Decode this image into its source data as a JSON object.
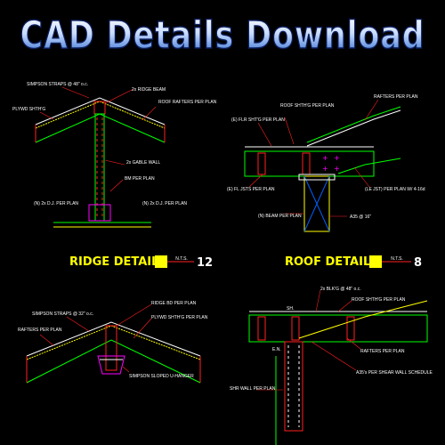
{
  "banner": {
    "title": "CAD Details Download"
  },
  "details": [
    {
      "title": "RIDGE DETAIL",
      "scale": "N.T.S.",
      "number": "12",
      "labels": {
        "simpson": "SIMPSON STRAPS @ 48\" o.c.",
        "ridge_beam": "2x RIDGE BEAM",
        "plywood": "PLYWD SHTH'G",
        "roof_rafters": "ROOF RAFTERS PER PLAN",
        "gable_wall": "2x GABLE WALL",
        "bm": "BM PER PLAN",
        "dl_left": "(N) 2x D.J. PER PLAN",
        "dl_right": "(N) 2x D.J. PER PLAN"
      }
    },
    {
      "title": "ROOF DETAIL",
      "scale": "N.T.S.",
      "number": "8",
      "labels": {
        "roof_sheathing": "ROOF SHTH'G PER PLAN",
        "rafters": "RAFTERS PER PLAN",
        "fl_shtg": "(E) FLR SHT'G PER PLAN",
        "fl_joists": "(E) FL JSTS PER PLAN",
        "beam": "(N) BEAM PER PLAN",
        "le_jsts": "(LE JST) PER PLAN W/ 4-16d",
        "a35": "A35 @ 16\""
      }
    },
    {
      "title": "",
      "labels": {
        "simpson": "SIMPSON STRAPS @ 32\" o.c.",
        "rafters": "RAFTERS PER PLAN",
        "ridge": "RIDGE BD PER PLAN",
        "plywd": "PLYWD SHTH'G PER PLAN",
        "hanger": "SIMPSON SLOPED U-HANGER"
      }
    },
    {
      "title": "",
      "labels": {
        "blkg": "2x BLK'G @ 48\" o.c.",
        "roof_shtg": "ROOF SHTH'G PER PLAN",
        "sh": "SH.",
        "en": "E.N.",
        "rafters": "RAFTERS PER PLAN",
        "a35": "A35's PER SHEAR WALL SCHEDULE",
        "shear_wall": "SHR WALL PER PLAN"
      }
    }
  ],
  "colors": {
    "background": "#000000",
    "banner_fill_top": "#ffffff",
    "banner_fill_bottom": "#1e5fc9",
    "cad_yellow": "#ffff00",
    "cad_green": "#00ff00",
    "cad_red": "#ff2020",
    "cad_magenta": "#ff00ff",
    "cad_white": "#ffffff"
  }
}
